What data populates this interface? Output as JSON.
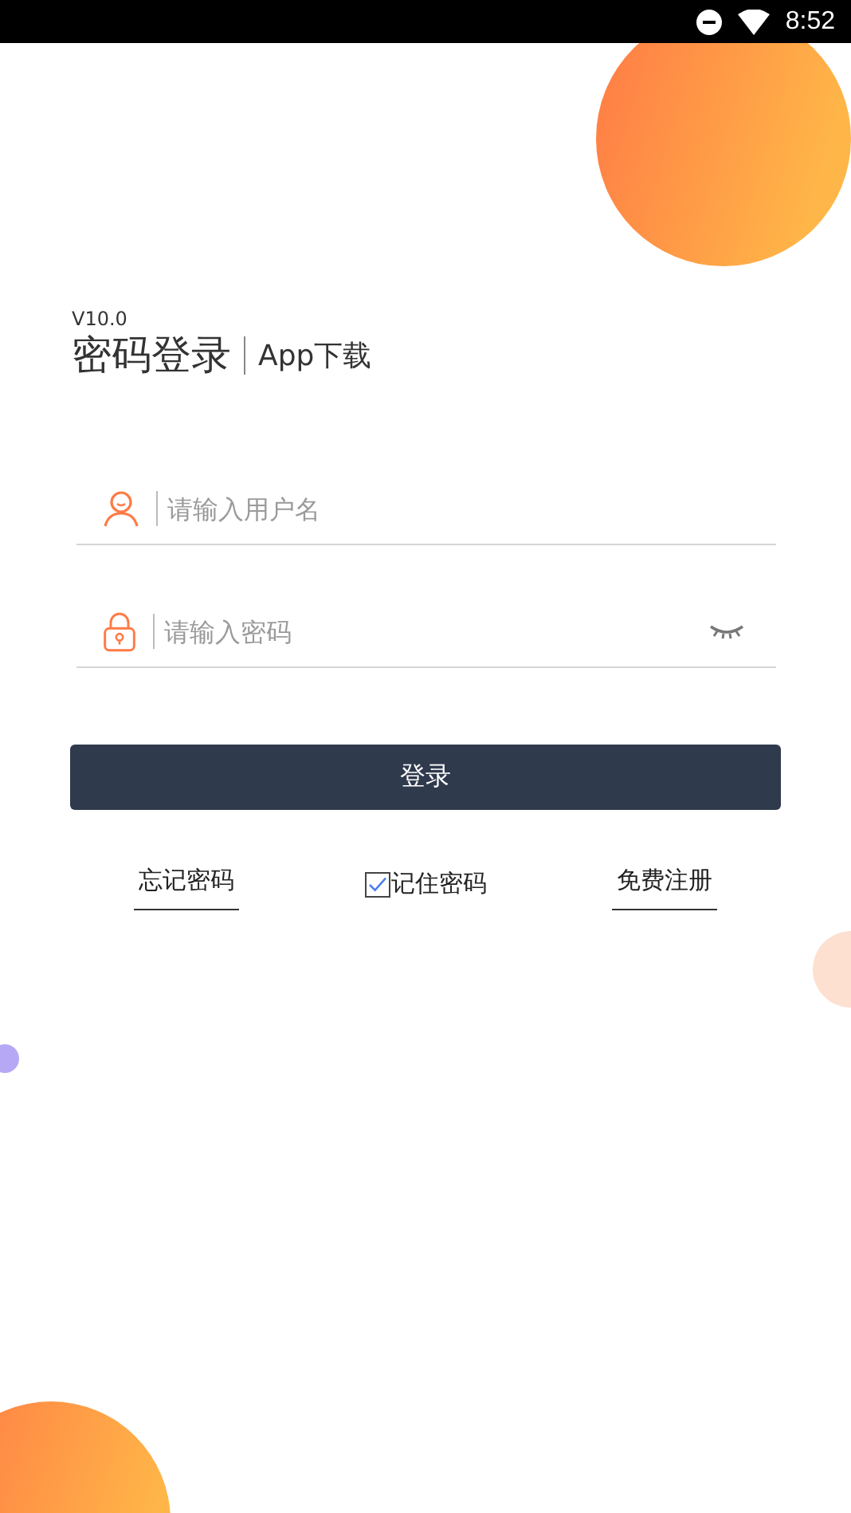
{
  "status_bar": {
    "time": "8:52"
  },
  "header": {
    "version": "V10.0",
    "title": "密码登录",
    "link": "App下载"
  },
  "fields": [
    {
      "kind": "user",
      "placeholder": "请输入用户名"
    },
    {
      "kind": "password",
      "placeholder": "请输入密码"
    }
  ],
  "login_button": "登录",
  "links": [
    {
      "kind": "link",
      "label": "忘记密码"
    },
    {
      "kind": "checkbox",
      "label": "记住密码",
      "checked": true
    },
    {
      "kind": "link",
      "label": "免费注册"
    }
  ]
}
